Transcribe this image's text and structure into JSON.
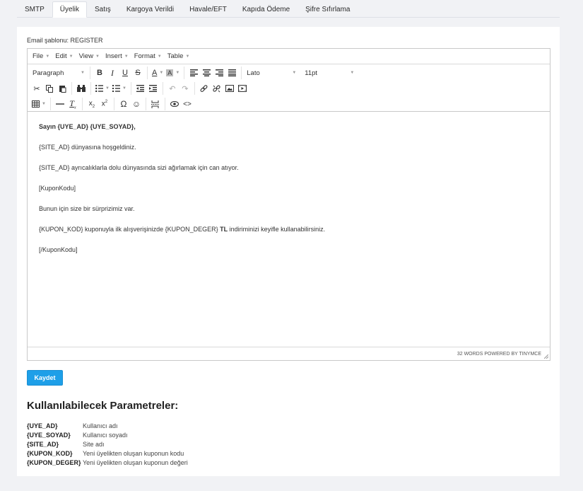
{
  "tabs": [
    {
      "label": "SMTP",
      "active": false
    },
    {
      "label": "Üyelik",
      "active": true
    },
    {
      "label": "Satış",
      "active": false
    },
    {
      "label": "Kargoya Verildi",
      "active": false
    },
    {
      "label": "Havale/EFT",
      "active": false
    },
    {
      "label": "Kapıda Ödeme",
      "active": false
    },
    {
      "label": "Şifre Sıfırlama",
      "active": false
    }
  ],
  "template_label": "Email şablonu: REGISTER",
  "editor": {
    "menu": [
      "File",
      "Edit",
      "View",
      "Insert",
      "Format",
      "Table"
    ],
    "toolbar": {
      "block_format": "Paragraph",
      "font_family": "Lato",
      "font_size": "11pt",
      "buttons_row1": [
        "bold-icon",
        "italic-icon",
        "underline-icon",
        "strikethrough-icon",
        "text-color-icon",
        "background-color-icon",
        "align-left-icon",
        "align-center-icon",
        "align-right-icon",
        "align-justify-icon"
      ],
      "buttons_row2": [
        "cut-icon",
        "copy-icon",
        "paste-icon",
        "find-replace-icon",
        "bullet-list-icon",
        "numbered-list-icon",
        "outdent-icon",
        "indent-icon",
        "undo-icon",
        "redo-icon",
        "link-icon",
        "unlink-icon",
        "image-icon",
        "media-icon"
      ],
      "buttons_row3": [
        "table-icon",
        "horizontal-rule-icon",
        "clear-format-icon",
        "subscript-icon",
        "superscript-icon",
        "special-char-icon",
        "emoticons-icon",
        "page-break-icon",
        "preview-icon",
        "source-code-icon"
      ]
    },
    "content": {
      "greeting": "Sayın {UYE_AD} {UYE_SOYAD},",
      "line1": "{SITE_AD} dünyasına hoşgeldiniz.",
      "line2": "{SITE_AD} ayrıcalıklarla dolu dünyasında sizi ağırlamak için can atıyor.",
      "line3": "[KuponKodu]",
      "line4": "Bunun için size bir sürprizimiz var.",
      "line5_a": "{KUPON_KOD} kuponuyla ilk alışverişinizde {KUPON_DEGER} ",
      "line5_bold": "TL",
      "line5_b": " indiriminizi keyifle kullanabilirsiniz.",
      "line6": "[/KuponKodu]"
    },
    "status": "32 WORDS POWERED BY TINYMCE"
  },
  "save_label": "Kaydet",
  "params_title": "Kullanılabilecek Parametreler:",
  "params": [
    {
      "key": "{UYE_AD}",
      "desc": "Kullanıcı adı"
    },
    {
      "key": "{UYE_SOYAD}",
      "desc": "Kullanıcı soyadı"
    },
    {
      "key": "{SITE_AD}",
      "desc": "Site adı"
    },
    {
      "key": "{KUPON_KOD}",
      "desc": "Yeni üyelikten oluşan kuponun kodu"
    },
    {
      "key": "{KUPON_DEGER}",
      "desc": "Yeni üyelikten oluşan kuponun değeri"
    }
  ],
  "colors": {
    "accent": "#1e9fe8",
    "page_bg": "#f1f2f5"
  }
}
